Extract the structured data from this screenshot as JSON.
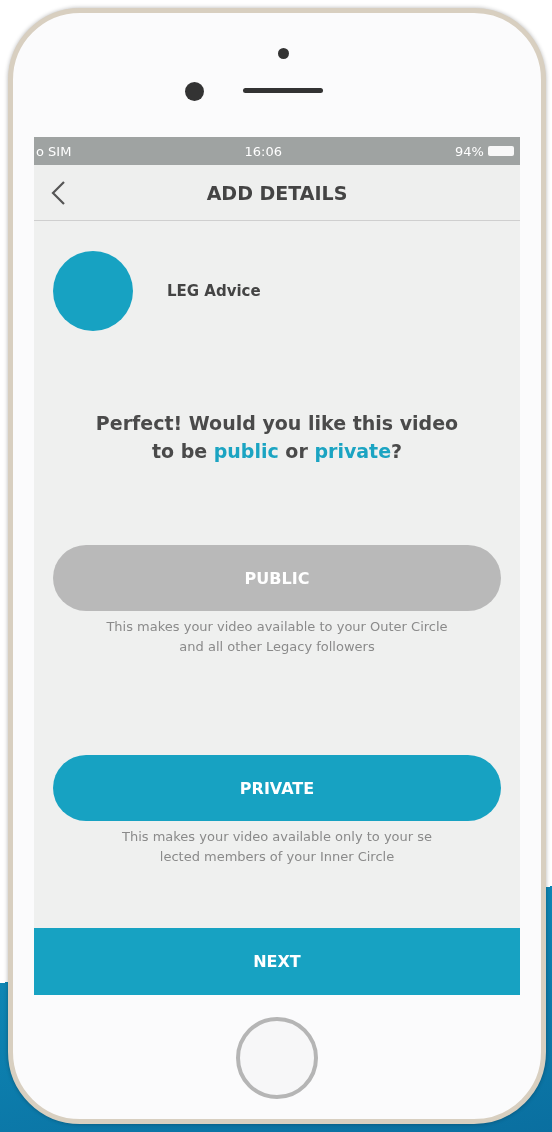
{
  "status_bar": {
    "carrier": "o SIM",
    "time": "16:06",
    "battery": "94%"
  },
  "nav": {
    "title": "ADD DETAILS"
  },
  "profile": {
    "name": "LEG Advice"
  },
  "question": "Perfect! Would you like this video to be **public** or **private**?",
  "options": [
    {
      "label": "PUBLIC",
      "selected": false,
      "description": "This makes your video available to your Outer Circle and all other Legacy followers"
    },
    {
      "label": "PRIVATE",
      "selected": true,
      "description": "This makes your video available only to your se lected members of your Inner Circle"
    }
  ],
  "next_button": "NEXT"
}
